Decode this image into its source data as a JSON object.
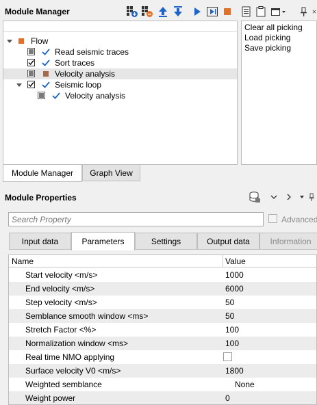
{
  "module_manager": {
    "title": "Module Manager",
    "toolbar_icons": [
      "add-module-icon",
      "remove-module-icon",
      "move-up-icon",
      "move-down-icon",
      "run-icon",
      "run-step-icon",
      "stop-icon",
      "notes-icon",
      "clipboard-icon",
      "window-menu-icon",
      "pin-icon",
      "close-icon"
    ],
    "tree": [
      {
        "label": "Flow",
        "level": 0
      },
      {
        "label": "Read seismic traces",
        "level": 1
      },
      {
        "label": "Sort traces",
        "level": 1
      },
      {
        "label": "Velocity analysis",
        "level": 1,
        "selected": true
      },
      {
        "label": "Seismic loop",
        "level": 1
      },
      {
        "label": "Velocity analysis",
        "level": 2
      }
    ],
    "picking_menu": [
      "Clear all picking",
      "Load picking",
      "Save picking"
    ],
    "tabs": [
      "Module Manager",
      "Graph View"
    ],
    "active_tab": "Module Manager"
  },
  "module_properties": {
    "title": "Module Properties",
    "header_icons": [
      "database-icon",
      "chevron-down-icon",
      "chevron-right-icon",
      "window-menu-icon",
      "pin-icon"
    ],
    "search_placeholder": "Search Property",
    "advanced_label": "Advanced",
    "tabs": [
      "Input data",
      "Parameters",
      "Settings",
      "Output data",
      "Information"
    ],
    "active_tab": "Parameters",
    "grid_headers": {
      "name": "Name",
      "value": "Value"
    },
    "rows": [
      {
        "name": "Start velocity <m/s>",
        "value": "1000"
      },
      {
        "name": "End velocity <m/s>",
        "value": "6000"
      },
      {
        "name": "Step velocity <m/s>",
        "value": "50"
      },
      {
        "name": "Semblance smooth window <ms>",
        "value": "50"
      },
      {
        "name": "Stretch Factor <%>",
        "value": "100"
      },
      {
        "name": "Normalization window <ms>",
        "value": "100"
      },
      {
        "name": "Real time NMO applying",
        "value": "",
        "checkbox": true,
        "checked": false
      },
      {
        "name": "Surface velocity V0 <m/s>",
        "value": "1800"
      },
      {
        "name": "Weighted semblance",
        "value": "None"
      },
      {
        "name": "Weight power",
        "value": "0"
      }
    ]
  },
  "colors": {
    "accent_blue": "#1e64c8",
    "stop_orange": "#e0702a",
    "flow_orange": "#e0702a"
  }
}
